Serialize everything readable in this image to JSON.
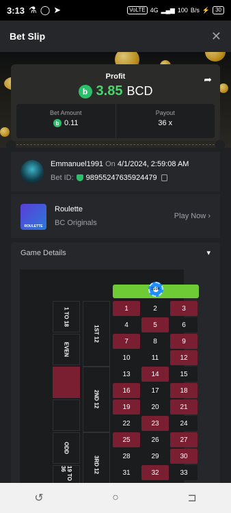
{
  "status": {
    "time": "3:13",
    "network": "VoLTE",
    "net_gen": "4G",
    "speed": "100",
    "speed_unit": "B/s",
    "battery": "30"
  },
  "header": {
    "title": "Bet Slip",
    "close_icon": "close-icon"
  },
  "profit": {
    "label": "Profit",
    "value": "3.85",
    "currency": "BCD",
    "share_icon": "share-icon"
  },
  "stats": {
    "bet_label": "Bet Amount",
    "bet_value": "0.11",
    "payout_label": "Payout",
    "payout_value": "36 x"
  },
  "user": {
    "name": "Emmanuel1991",
    "on": "On",
    "datetime": "4/1/2024, 2:59:08 AM",
    "betid_label": "Bet ID:",
    "bet_id": "98955247635924479"
  },
  "game": {
    "name": "Roulette",
    "provider": "BC Originals",
    "thumb_label": "ROULETTE",
    "play_label": "Play Now",
    "chevron": "›"
  },
  "details": {
    "title": "Game Details",
    "chevron": "▾"
  },
  "roulette": {
    "chip_label": "110K",
    "side_labels": [
      "1 TO 18",
      "EVEN",
      "ODD",
      "19 TO 36"
    ],
    "dozen_labels": [
      "1ST 12",
      "2ND 12",
      "3RD 12"
    ],
    "rows": [
      [
        {
          "n": "1",
          "c": "red"
        },
        {
          "n": "2",
          "c": "black"
        },
        {
          "n": "3",
          "c": "red"
        }
      ],
      [
        {
          "n": "4",
          "c": "black"
        },
        {
          "n": "5",
          "c": "red"
        },
        {
          "n": "6",
          "c": "black"
        }
      ],
      [
        {
          "n": "7",
          "c": "red"
        },
        {
          "n": "8",
          "c": "black"
        },
        {
          "n": "9",
          "c": "red"
        }
      ],
      [
        {
          "n": "10",
          "c": "black"
        },
        {
          "n": "11",
          "c": "black"
        },
        {
          "n": "12",
          "c": "red"
        }
      ],
      [
        {
          "n": "13",
          "c": "black"
        },
        {
          "n": "14",
          "c": "red"
        },
        {
          "n": "15",
          "c": "black"
        }
      ],
      [
        {
          "n": "16",
          "c": "red"
        },
        {
          "n": "17",
          "c": "black"
        },
        {
          "n": "18",
          "c": "red"
        }
      ],
      [
        {
          "n": "19",
          "c": "red"
        },
        {
          "n": "20",
          "c": "black"
        },
        {
          "n": "21",
          "c": "red"
        }
      ],
      [
        {
          "n": "22",
          "c": "black"
        },
        {
          "n": "23",
          "c": "red"
        },
        {
          "n": "24",
          "c": "black"
        }
      ],
      [
        {
          "n": "25",
          "c": "red"
        },
        {
          "n": "26",
          "c": "black"
        },
        {
          "n": "27",
          "c": "red"
        }
      ],
      [
        {
          "n": "28",
          "c": "black"
        },
        {
          "n": "29",
          "c": "black"
        },
        {
          "n": "30",
          "c": "red"
        }
      ],
      [
        {
          "n": "31",
          "c": "black"
        },
        {
          "n": "32",
          "c": "red"
        },
        {
          "n": "33",
          "c": "black"
        }
      ]
    ]
  },
  "nav": {
    "recent": "recent-apps-icon",
    "home": "home-icon",
    "back": "back-icon"
  }
}
